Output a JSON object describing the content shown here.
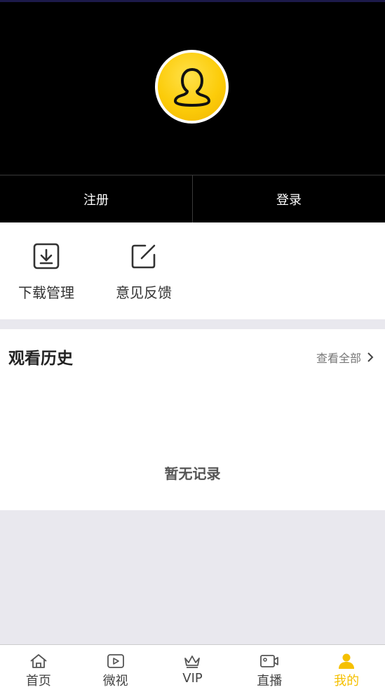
{
  "auth": {
    "register_label": "注册",
    "login_label": "登录"
  },
  "tools": [
    {
      "label": "下载管理",
      "icon": "download-icon"
    },
    {
      "label": "意见反馈",
      "icon": "edit-icon"
    }
  ],
  "history": {
    "title": "观看历史",
    "view_all": "查看全部",
    "empty_text": "暂无记录"
  },
  "tabbar": {
    "tabs": [
      {
        "label": "首页",
        "icon": "home-icon"
      },
      {
        "label": "微视",
        "icon": "play-icon"
      },
      {
        "label": "VIP",
        "icon": "crown-icon"
      },
      {
        "label": "直播",
        "icon": "video-camera-icon"
      },
      {
        "label": "我的",
        "icon": "user-icon",
        "active": true
      }
    ]
  },
  "colors": {
    "accent": "#f5c000",
    "header_bg": "#000000",
    "page_bg": "#e9e8ee"
  }
}
